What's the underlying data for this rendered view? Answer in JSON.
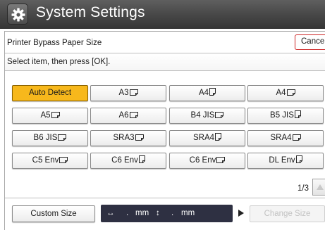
{
  "window": {
    "title": "System Settings",
    "icon": "gear-icon"
  },
  "header": {
    "setting_name": "Printer Bypass Paper Size",
    "cancel_label": "Cancel"
  },
  "instruction": "Select item, then press [OK].",
  "paper_sizes": [
    {
      "label": "Auto Detect",
      "orientation": "",
      "selected": true
    },
    {
      "label": "A3",
      "orientation": "landscape",
      "selected": false
    },
    {
      "label": "A4",
      "orientation": "portrait",
      "selected": false
    },
    {
      "label": "A4",
      "orientation": "landscape",
      "selected": false
    },
    {
      "label": "A5",
      "orientation": "landscape",
      "selected": false
    },
    {
      "label": "A6",
      "orientation": "landscape",
      "selected": false
    },
    {
      "label": "B4 JIS",
      "orientation": "landscape",
      "selected": false
    },
    {
      "label": "B5 JIS",
      "orientation": "portrait",
      "selected": false
    },
    {
      "label": "B6 JIS",
      "orientation": "landscape",
      "selected": false
    },
    {
      "label": "SRA3",
      "orientation": "landscape",
      "selected": false
    },
    {
      "label": "SRA4",
      "orientation": "portrait",
      "selected": false
    },
    {
      "label": "SRA4",
      "orientation": "landscape",
      "selected": false
    },
    {
      "label": "C5 Env",
      "orientation": "landscape",
      "selected": false
    },
    {
      "label": "C6 Env",
      "orientation": "portrait",
      "selected": false
    },
    {
      "label": "C6 Env",
      "orientation": "landscape",
      "selected": false
    },
    {
      "label": "DL Env",
      "orientation": "portrait",
      "selected": false
    }
  ],
  "pager": {
    "text": "1/3"
  },
  "custom": {
    "button_label": "Custom Size",
    "width_arrow": "↔",
    "width_value": ".",
    "width_unit": "mm",
    "height_arrow": "↕",
    "height_value": ".",
    "height_unit": "mm",
    "change_label": "Change Size"
  },
  "colors": {
    "selected": "#f7b81c",
    "titlebar": "#4a4a4a",
    "cancel_border": "#cc2222",
    "dim_box": "#2e3042"
  }
}
